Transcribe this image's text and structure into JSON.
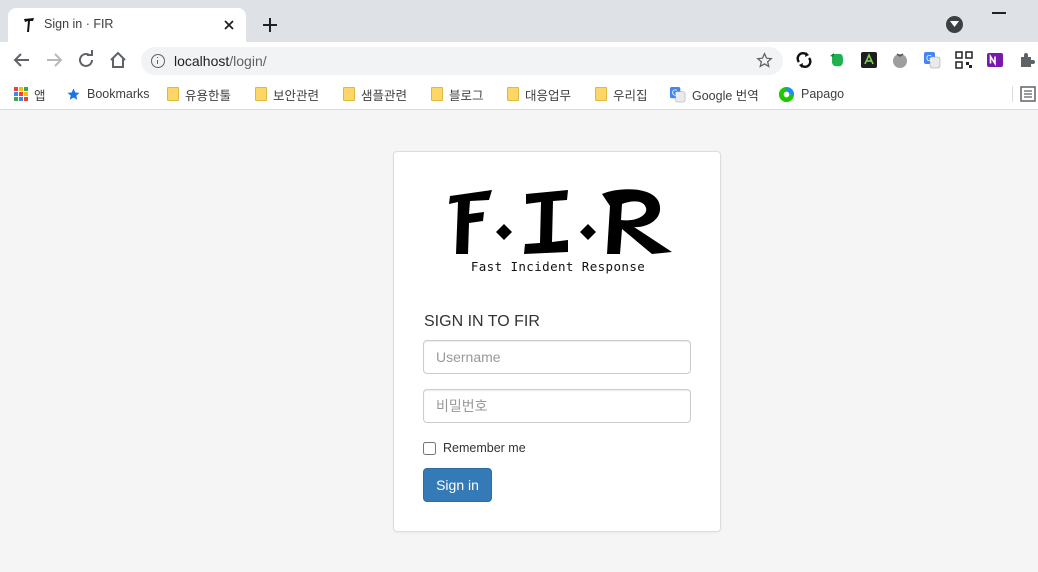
{
  "tab": {
    "title": "Sign in · FIR"
  },
  "address_bar": {
    "host": "localhost",
    "path": "/login/"
  },
  "bookmarks": {
    "apps_label": "앱",
    "items": [
      {
        "label": "Bookmarks",
        "icon": "star-icon"
      },
      {
        "label": "유용한툴",
        "icon": "folder-icon"
      },
      {
        "label": "보안관련",
        "icon": "folder-icon"
      },
      {
        "label": "샘플관련",
        "icon": "folder-icon"
      },
      {
        "label": "블로그",
        "icon": "folder-icon"
      },
      {
        "label": "대응업무",
        "icon": "folder-icon"
      },
      {
        "label": "우리집",
        "icon": "folder-icon"
      },
      {
        "label": "Google 번역",
        "icon": "google-translate-icon"
      },
      {
        "label": "Papago",
        "icon": "papago-icon"
      }
    ]
  },
  "login": {
    "logo_text": "F.I.R",
    "logo_subtitle": "Fast Incident Response",
    "title": "SIGN IN TO FIR",
    "username_placeholder": "Username",
    "password_placeholder": "비밀번호",
    "remember_label": "Remember me",
    "signin_label": "Sign in"
  },
  "colors": {
    "primary_button": "#337ab7",
    "page_background": "#f5f5f5",
    "tabstrip": "#dee1e6"
  }
}
